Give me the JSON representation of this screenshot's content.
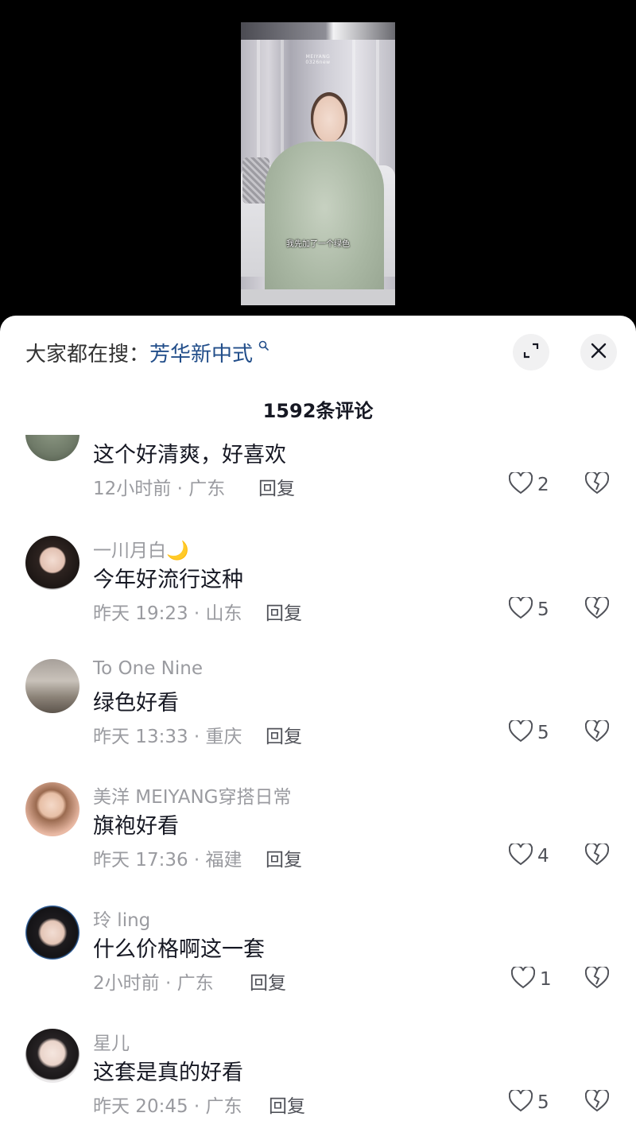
{
  "video": {
    "watermark": "MEIYANG\n0326new",
    "subtitle": "我先加了一个绿色"
  },
  "sheet": {
    "search_prefix": "大家都在搜：",
    "search_keyword": "芳华新中式",
    "comment_count": "1592条评论"
  },
  "comments": [
    {
      "user": "",
      "text": "这个好清爽，好喜欢",
      "time": "12小时前 · 广东",
      "reply": "回复",
      "likes": "2"
    },
    {
      "user": "一川月白🌙",
      "text": "今年好流行这种",
      "time": "昨天 19:23 · 山东",
      "reply": "回复",
      "likes": "5"
    },
    {
      "user": "To  One Nine",
      "text": "绿色好看",
      "time": "昨天 13:33 · 重庆",
      "reply": "回复",
      "likes": "5"
    },
    {
      "user": "美洋 MEIYANG穿搭日常",
      "text": "旗袍好看",
      "time": "昨天 17:36 · 福建",
      "reply": "回复",
      "likes": "4"
    },
    {
      "user": "玲 ling",
      "text": "什么价格啊这一套",
      "time": "2小时前 · 广东",
      "reply": "回复",
      "likes": "1"
    },
    {
      "user": "星儿",
      "text": "这套是真的好看",
      "time": "昨天 20:45 · 广东",
      "reply": "回复",
      "likes": "5"
    }
  ],
  "colors": {
    "keyword": "#224e8a",
    "primary_text": "#161823",
    "secondary_text": "#9a9ba0"
  },
  "icons": {
    "search": "search-icon",
    "expand": "expand-icon",
    "close": "close-icon",
    "like": "heart-outline-icon",
    "dislike": "broken-heart-icon"
  }
}
